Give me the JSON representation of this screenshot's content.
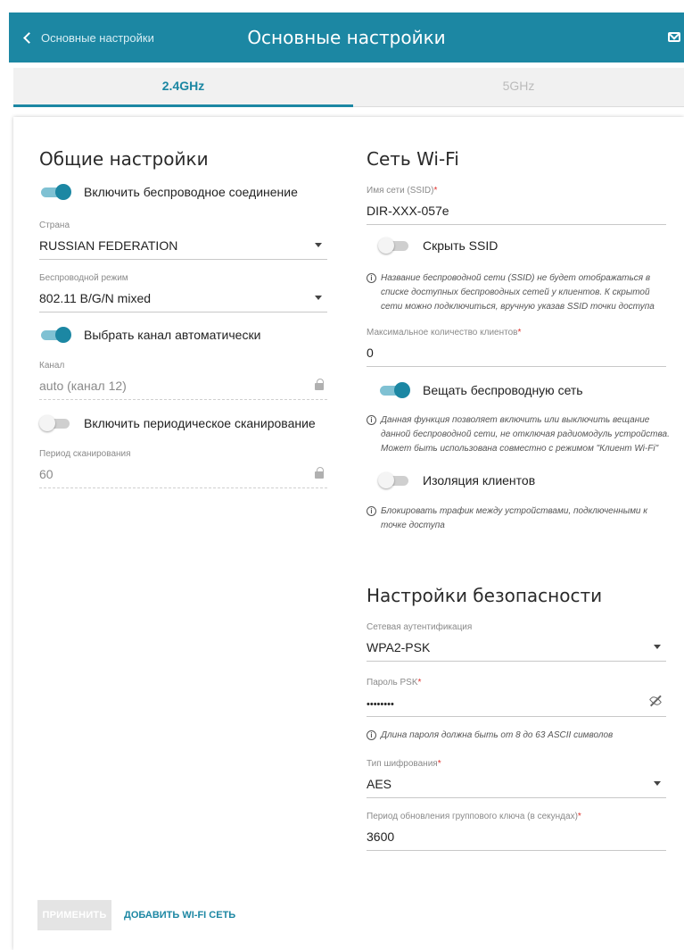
{
  "header": {
    "back_label": "Основные настройки",
    "title": "Основные настройки"
  },
  "tabs": [
    {
      "label": "2.4GHz",
      "active": true
    },
    {
      "label": "5GHz",
      "active": false
    }
  ],
  "general": {
    "heading": "Общие настройки",
    "enable_wireless": {
      "label": "Включить беспроводное соединение",
      "on": true
    },
    "country": {
      "label": "Страна",
      "value": "RUSSIAN FEDERATION"
    },
    "mode": {
      "label": "Беспроводной режим",
      "value": "802.11 B/G/N mixed"
    },
    "auto_channel": {
      "label": "Выбрать канал автоматически",
      "on": true
    },
    "channel": {
      "label": "Канал",
      "value": "auto (канал 12)"
    },
    "periodic_scan": {
      "label": "Включить периодическое сканирование",
      "on": false
    },
    "scan_period": {
      "label": "Период сканирования",
      "value": "60"
    }
  },
  "wifi": {
    "heading": "Сеть Wi-Fi",
    "ssid": {
      "label": "Имя сети (SSID)",
      "required_mark": "*",
      "value": "DIR-XXX-057e"
    },
    "hide_ssid": {
      "label": "Скрыть SSID",
      "on": false
    },
    "hide_ssid_hint": "Название беспроводной сети (SSID) не будет отображаться в списке доступных беспроводных сетей у клиентов. К скрытой сети можно подключиться, вручную указав SSID точки доступа",
    "max_clients": {
      "label": "Максимальное количество клиентов",
      "required_mark": "*",
      "value": "0"
    },
    "broadcast": {
      "label": "Вещать беспроводную сеть",
      "on": true
    },
    "broadcast_hint": "Данная функция позволяет включить или выключить вещание данной беспроводной сети, не отключая радиомодуль устройства. Может быть использована совместно с режимом \"Клиент Wi-Fi\"",
    "isolation": {
      "label": "Изоляция клиентов",
      "on": false
    },
    "isolation_hint": "Блокировать трафик между устройствами, подключенными к точке доступа"
  },
  "security": {
    "heading": "Настройки безопасности",
    "auth": {
      "label": "Сетевая аутентификация",
      "value": "WPA2-PSK"
    },
    "psk": {
      "label": "Пароль PSK",
      "required_mark": "*",
      "value": "••••••••"
    },
    "psk_hint": "Длина пароля должна быть от 8 до 63 ASCII символов",
    "cipher": {
      "label": "Тип шифрования",
      "required_mark": "*",
      "value": "AES"
    },
    "rekey": {
      "label": "Период обновления группового ключа (в секундах)",
      "required_mark": "*",
      "value": "3600"
    }
  },
  "actions": {
    "apply_label": "ПРИМЕНИТЬ",
    "add_label": "ДОБАВИТЬ WI-FI СЕТЬ"
  },
  "icons": {
    "back": "chevron-left-icon",
    "mail": "mail-icon",
    "info": "info-icon",
    "lock": "lock-icon",
    "dropdown": "caret-down-icon",
    "password_visibility": "eye-off-icon"
  },
  "colors": {
    "accent": "#1c87a3",
    "toggle_track_on": "#7fc1d3",
    "required": "#e0322c",
    "disabled_button": "#e4e4e4"
  }
}
